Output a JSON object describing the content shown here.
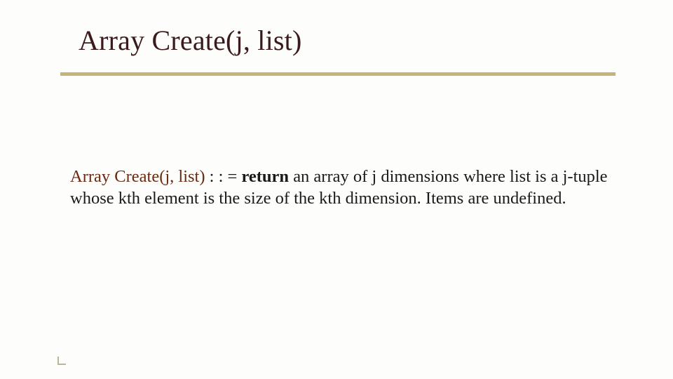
{
  "slide": {
    "title": "Array Create(j, list)",
    "definition": {
      "fn": "Array Create(j, list)",
      "op": "  : : = ",
      "kw": "return",
      "rest1": " an array of  j dimensions where list is a j-tuple whose kth element is the size of the kth dimension. Items are undefined."
    }
  }
}
